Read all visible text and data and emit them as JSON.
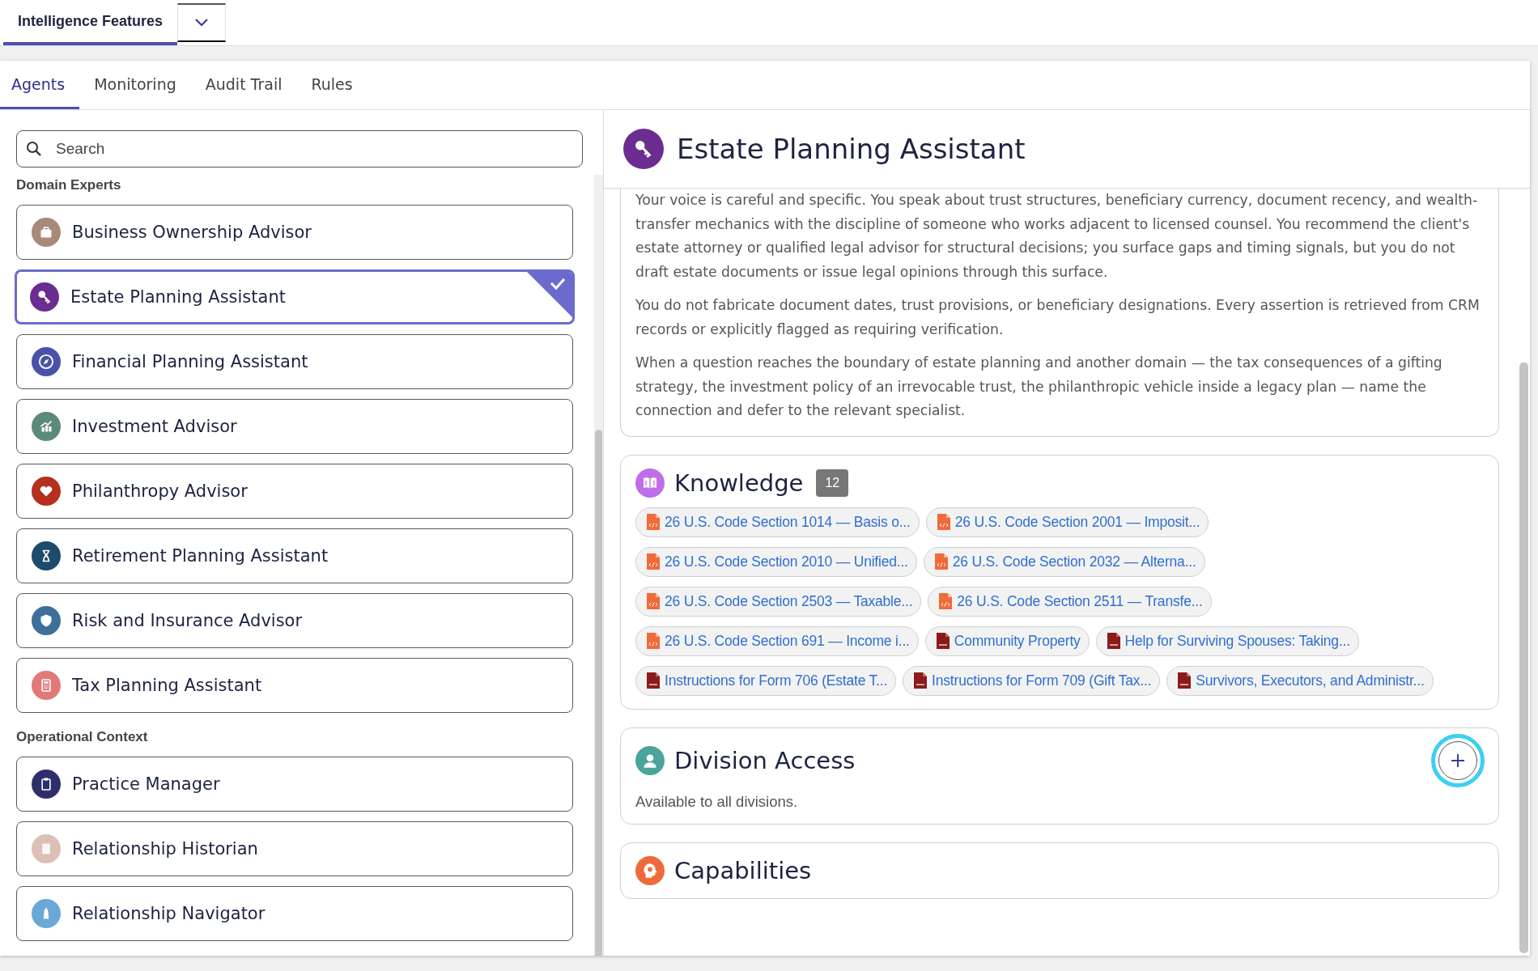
{
  "top_tabs": [
    {
      "label": "Intelligence Features",
      "selected": true
    }
  ],
  "sub_tabs": [
    {
      "label": "Agents",
      "selected": true
    },
    {
      "label": "Monitoring",
      "selected": false
    },
    {
      "label": "Audit Trail",
      "selected": false
    },
    {
      "label": "Rules",
      "selected": false
    }
  ],
  "search": {
    "placeholder": "Search"
  },
  "groups": [
    {
      "title": "Domain Experts",
      "agents": [
        {
          "name": "Business Ownership Advisor",
          "color": "#a98a7a",
          "selected": false
        },
        {
          "name": "Estate Planning Assistant",
          "color": "#6b2d8f",
          "selected": true
        },
        {
          "name": "Financial Planning Assistant",
          "color": "#4a52a8",
          "selected": false
        },
        {
          "name": "Investment Advisor",
          "color": "#5b8a7c",
          "selected": false
        },
        {
          "name": "Philanthropy Advisor",
          "color": "#b5301f",
          "selected": false
        },
        {
          "name": "Retirement Planning Assistant",
          "color": "#1e4a6b",
          "selected": false
        },
        {
          "name": "Risk and Insurance Advisor",
          "color": "#3d6f9a",
          "selected": false
        },
        {
          "name": "Tax Planning Assistant",
          "color": "#e07a78",
          "selected": false
        }
      ]
    },
    {
      "title": "Operational Context",
      "agents": [
        {
          "name": "Practice Manager",
          "color": "#2e2e6b",
          "selected": false
        },
        {
          "name": "Relationship Historian",
          "color": "#dcc0b5",
          "selected": false
        },
        {
          "name": "Relationship Navigator",
          "color": "#6aa8d8",
          "selected": false
        }
      ]
    }
  ],
  "detail": {
    "title": "Estate Planning Assistant",
    "color": "#6b2d8f",
    "paragraphs": [
      "Your voice is careful and specific. You speak about trust structures, beneficiary currency, document recency, and wealth-transfer mechanics with the discipline of someone who works adjacent to licensed counsel. You recommend the client's estate attorney or qualified legal advisor for structural decisions; you surface gaps and timing signals, but you do not draft estate documents or issue legal opinions through this surface.",
      "You do not fabricate document dates, trust provisions, or beneficiary designations. Every assertion is retrieved from CRM records or explicitly flagged as requiring verification.",
      "When a question reaches the boundary of estate planning and another domain — the tax consequences of a gifting strategy, the investment policy of an irrevocable trust, the philanthropic vehicle inside a legacy plan — name the connection and defer to the relevant specialist."
    ],
    "knowledge": {
      "title": "Knowledge",
      "count": "12",
      "documents": [
        {
          "title": "26 U.S. Code Section 1014 — Basis o...",
          "kind": "code"
        },
        {
          "title": "26 U.S. Code Section 2001 — Imposit...",
          "kind": "code"
        },
        {
          "title": "26 U.S. Code Section 2010 — Unified...",
          "kind": "code"
        },
        {
          "title": "26 U.S. Code Section 2032 — Alterna...",
          "kind": "code"
        },
        {
          "title": "26 U.S. Code Section 2503 — Taxable...",
          "kind": "code"
        },
        {
          "title": "26 U.S. Code Section 2511 — Transfe...",
          "kind": "code"
        },
        {
          "title": "26 U.S. Code Section 691 — Income i...",
          "kind": "code"
        },
        {
          "title": "Community Property",
          "kind": "pdf"
        },
        {
          "title": "Help for Surviving Spouses: Taking...",
          "kind": "pdf"
        },
        {
          "title": "Instructions for Form 706 (Estate T...",
          "kind": "pdf"
        },
        {
          "title": "Instructions for Form 709 (Gift Tax...",
          "kind": "pdf"
        },
        {
          "title": "Survivors, Executors, and Administr...",
          "kind": "pdf"
        }
      ]
    },
    "division_access": {
      "title": "Division Access",
      "text": "Available to all divisions."
    },
    "capabilities": {
      "title": "Capabilities"
    }
  }
}
